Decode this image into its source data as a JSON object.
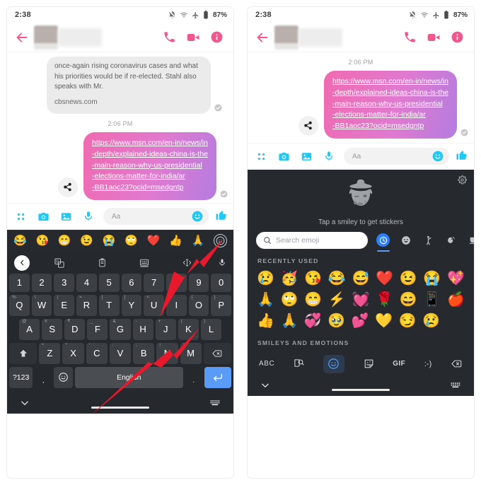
{
  "meta": {
    "app": "Messenger",
    "accent_pink": "#f5558d",
    "accent_blue": "#1fc8f5",
    "keyboard_bg": "#25282c",
    "tray_bg": "#262a2e",
    "annotation_color": "#e8192c"
  },
  "statusbar": {
    "time": "2:38",
    "battery_text": "87%",
    "icons": [
      "notifications-off-icon",
      "wifi-icon",
      "airplane-mode-icon",
      "battery-icon"
    ]
  },
  "header": {
    "back_label": "Back",
    "contact_name_redacted": "",
    "actions": [
      "call-icon",
      "video-call-icon",
      "info-icon"
    ]
  },
  "conversation": {
    "incoming_message": "once-again rising coronavirus cases and what his priorities would be if re-elected. Stahl also speaks with Mr.",
    "incoming_domain": "cbsnews.com",
    "timestamp": "2:06 PM",
    "outgoing_url_lines": [
      "https://www.msn.com/en-in/news/in",
      "-depth/explained-ideas-china-is-the",
      "-main-reason-why-us-presidential",
      "-elections-matter-for-india/ar",
      "-BB1aoc23?ocid=msedgntp"
    ],
    "outgoing_url": "https://www.msn.com/en-in/news/in-depth/explained-ideas-china-is-the-main-reason-why-us-presidential-elections-matter-for-india/ar-BB1aoc23?ocid=msedgntp",
    "share_label": "Share",
    "delivery_status": "Delivered"
  },
  "composer": {
    "icons": [
      "apps-grid-icon",
      "camera-icon",
      "gallery-icon",
      "microphone-icon"
    ],
    "placeholder": "Aa",
    "value": "",
    "emoji_button": "smiley-icon",
    "like_button": "thumbs-up-icon"
  },
  "emoji_strip": {
    "emojis": [
      "😂",
      "😘",
      "😁",
      "😉",
      "😭",
      "🙄",
      "❤️",
      "👍",
      "🙏"
    ],
    "open_button": "smiley-outline-icon"
  },
  "keyboard": {
    "toolbar_icons": [
      "chevron-left-icon",
      "translate-icon",
      "clipboard-icon",
      "sticker-keyboard-icon",
      "text-edit-icon",
      "microphone-icon"
    ],
    "row_numbers": [
      "1",
      "2",
      "3",
      "4",
      "5",
      "6",
      "7",
      "8",
      "9",
      "0"
    ],
    "row1": [
      {
        "k": "Q",
        "s": "%"
      },
      {
        "k": "W",
        "s": "\\"
      },
      {
        "k": "E",
        "s": "|"
      },
      {
        "k": "R",
        "s": "="
      },
      {
        "k": "T",
        "s": "["
      },
      {
        "k": "Y",
        "s": "]"
      },
      {
        "k": "U",
        "s": "<"
      },
      {
        "k": "I",
        "s": ">"
      },
      {
        "k": "O",
        "s": "{"
      },
      {
        "k": "P",
        "s": "}"
      }
    ],
    "row2": [
      {
        "k": "A",
        "s": "@"
      },
      {
        "k": "S",
        "s": "#"
      },
      {
        "k": "D",
        "s": "₹"
      },
      {
        "k": "F",
        "s": "_"
      },
      {
        "k": "G",
        "s": "&"
      },
      {
        "k": "H",
        "s": "-"
      },
      {
        "k": "J",
        "s": "+"
      },
      {
        "k": "K",
        "s": "("
      },
      {
        "k": "L",
        "s": ")"
      }
    ],
    "row3": [
      {
        "k": "Z",
        "s": "*"
      },
      {
        "k": "X",
        "s": "\""
      },
      {
        "k": "C",
        "s": "'"
      },
      {
        "k": "V",
        "s": ":"
      },
      {
        "k": "B",
        "s": ";"
      },
      {
        "k": "N",
        "s": "!"
      },
      {
        "k": "M",
        "s": "?"
      }
    ],
    "shift_key": "shift-icon",
    "delete_key": "backspace-icon",
    "sym_key": "?123",
    "comma_key": ",",
    "emoji_key": "smiley-icon",
    "space_key": "English",
    "period_key": ".",
    "enter_key": "enter-icon",
    "nav": [
      "chevron-down-icon",
      "keyboard-icon"
    ]
  },
  "tray": {
    "settings_icon": "gear-icon",
    "hero_art": "cowboy-kiss-avatar",
    "hero_caption": "Tap a smiley to get stickers",
    "search": {
      "icon": "search-icon",
      "placeholder": "Search emoji",
      "value": ""
    },
    "categories": [
      {
        "name": "recent",
        "icon": "clock-icon",
        "active": true
      },
      {
        "name": "smileys",
        "icon": "smiley-icon",
        "active": false
      },
      {
        "name": "people",
        "icon": "person-icon",
        "active": false
      },
      {
        "name": "animals-nature",
        "icon": "animal-plant-icon",
        "active": false
      },
      {
        "name": "food-drink",
        "icon": "food-drink-icon",
        "active": false
      }
    ],
    "more_icon": "more-categories-icon",
    "section_recent": "RECENTLY USED",
    "section_smileys": "SMILEYS AND EMOTIONS",
    "recent_rows": [
      [
        "😢",
        "🥳",
        "😘",
        "😂",
        "😅",
        "❤️",
        "😉",
        "😭",
        "💖"
      ],
      [
        "🙏",
        "🙄",
        "😁",
        "⚡",
        "💓",
        "🌹",
        "😄",
        "📱",
        "🍎"
      ],
      [
        "👍",
        "🙏",
        "💞",
        "🥹",
        "💕",
        "💛",
        "😏",
        "😢"
      ]
    ],
    "bottom_bar": [
      {
        "name": "abc-key",
        "label": "ABC",
        "kind": "text"
      },
      {
        "name": "sticker-search-icon",
        "label": "",
        "kind": "icon"
      },
      {
        "name": "emoji-tab-icon",
        "label": "",
        "kind": "icon-active"
      },
      {
        "name": "sticker-tab-icon",
        "label": "",
        "kind": "icon"
      },
      {
        "name": "gif-tab",
        "label": "GIF",
        "kind": "text"
      },
      {
        "name": "kaomoji-tab",
        "label": ":-)",
        "kind": "text"
      },
      {
        "name": "backspace-key",
        "label": "",
        "kind": "icon"
      }
    ],
    "nav": [
      "chevron-down-icon",
      "keyboard-icon"
    ]
  }
}
